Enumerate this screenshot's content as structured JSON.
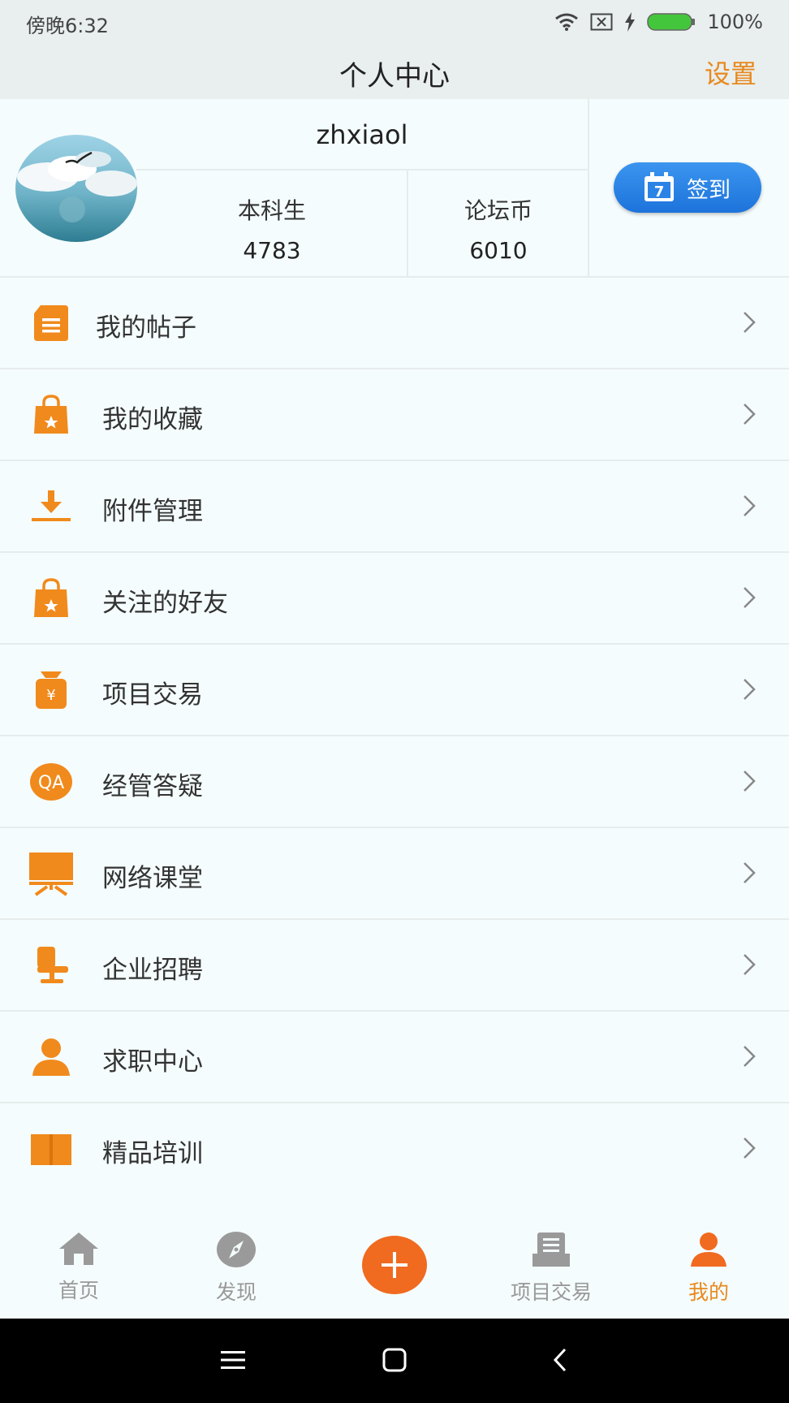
{
  "status_bar": {
    "time": "傍晚6:32",
    "battery": "100%"
  },
  "header": {
    "title": "个人中心",
    "settings": "设置"
  },
  "profile": {
    "username": "zhxiaol",
    "stats": [
      {
        "label": "本科生",
        "value": "4783"
      },
      {
        "label": "论坛币",
        "value": "6010"
      }
    ],
    "signin_label": "签到",
    "calendar_digit": "7"
  },
  "menu": [
    {
      "label": "我的帖子",
      "icon": "document-icon"
    },
    {
      "label": "我的收藏",
      "icon": "shopping-bag-star-icon"
    },
    {
      "label": "附件管理",
      "icon": "download-icon"
    },
    {
      "label": "关注的好友",
      "icon": "shopping-bag-star-icon"
    },
    {
      "label": "项目交易",
      "icon": "money-bag-icon"
    },
    {
      "label": "经管答疑",
      "icon": "qa-icon"
    },
    {
      "label": "网络课堂",
      "icon": "easel-icon"
    },
    {
      "label": "企业招聘",
      "icon": "office-chair-icon"
    },
    {
      "label": "求职中心",
      "icon": "person-icon"
    },
    {
      "label": "精品培训",
      "icon": "open-book-icon"
    }
  ],
  "tabs": [
    {
      "label": "首页",
      "icon": "home-icon"
    },
    {
      "label": "发现",
      "icon": "compass-icon"
    },
    {
      "label": "项目交易",
      "icon": "project-icon"
    },
    {
      "label": "我的",
      "icon": "person-icon"
    }
  ],
  "colors": {
    "accent": "#e8891d",
    "icon_orange": "#f08a1c",
    "button_blue": "#2b83e6",
    "plus_red": "#f06a1f"
  }
}
